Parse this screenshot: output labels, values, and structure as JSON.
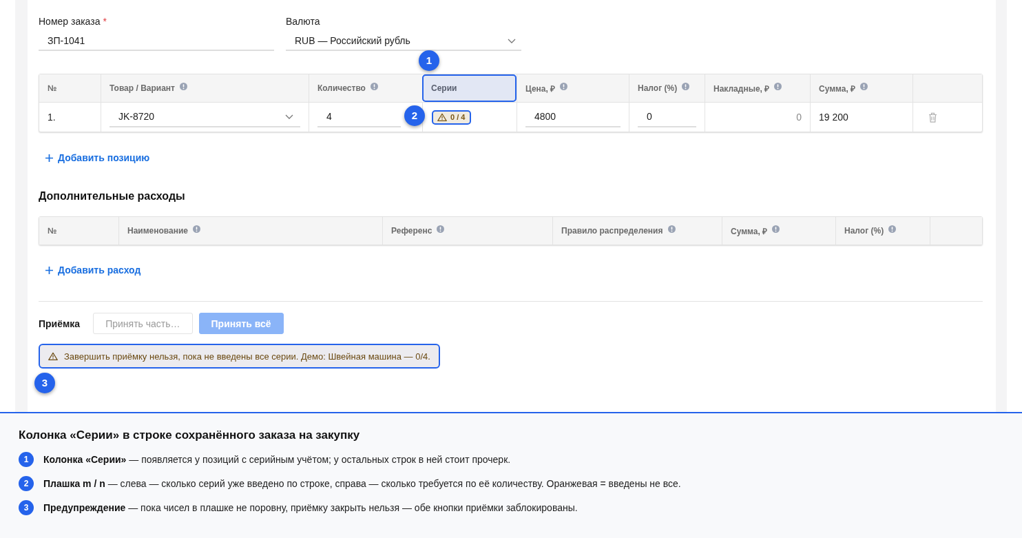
{
  "order_number": {
    "label": "Номер заказа",
    "required_mark": "*",
    "value": "ЗП-1041"
  },
  "currency": {
    "label": "Валюта",
    "value": "RUB — Российский рубль"
  },
  "items_table": {
    "columns": [
      {
        "label": "№",
        "info": false,
        "highlighted": false
      },
      {
        "label": "Товар / Вариант",
        "info": true,
        "highlighted": false
      },
      {
        "label": "Количество",
        "info": true,
        "highlighted": false
      },
      {
        "label": "Серии",
        "info": false,
        "highlighted": true,
        "callout": "1"
      },
      {
        "label": "Цена, ₽",
        "info": true,
        "highlighted": false
      },
      {
        "label": "Налог (%)",
        "info": true,
        "highlighted": false
      },
      {
        "label": "Накладные, ₽",
        "info": true,
        "highlighted": false
      },
      {
        "label": "Сумма, ₽",
        "info": true,
        "highlighted": false
      }
    ],
    "rows": [
      {
        "number": "1.",
        "product": "JK-8720",
        "quantity": "4",
        "series": {
          "text": "0 / 4",
          "complete": false,
          "highlighted": true,
          "callout": "2"
        },
        "price": "4800",
        "tax": "0",
        "overhead": "0",
        "sum": "19 200",
        "deletable": true
      }
    ],
    "add_label": "Добавить позицию"
  },
  "expenses": {
    "title": "Дополнительные расходы",
    "columns": [
      {
        "label": "№",
        "info": false
      },
      {
        "label": "Наименование",
        "info": true
      },
      {
        "label": "Референс",
        "info": true
      },
      {
        "label": "Правило распределения",
        "info": true
      },
      {
        "label": "Сумма, ₽",
        "info": true
      },
      {
        "label": "Налог (%)",
        "info": true
      }
    ],
    "add_label": "Добавить расход"
  },
  "receiving": {
    "label": "Приёмка",
    "buttons": [
      {
        "label": "Принять часть…",
        "kind": "secondary",
        "disabled": true
      },
      {
        "label": "Принять всё",
        "kind": "primary",
        "disabled": true
      }
    ],
    "warning": {
      "text": "Завершить приёмку нельзя, пока не введены все серии. Демо: Швейная машина — 0/4.",
      "highlighted": true,
      "callout": "3"
    }
  },
  "legend": {
    "title": "Колонка «Серии» в строке сохранённого заказа на закупку",
    "items": [
      {
        "number": "1",
        "text": "**Колонка «Серии»** — появляется у позиций с серийным учётом; у остальных строк в ней стоит прочерк."
      },
      {
        "number": "2",
        "text": "**Плашка m / n** — слева — сколько серий уже введено по строке, справа — сколько требуется по её количеству. Оранжевая = введены не все."
      },
      {
        "number": "3",
        "text": "**Предупреждение** — пока чисел в плашке не поровну, приёмку закрыть нельзя — обе кнопки приёмки заблокированы."
      }
    ]
  }
}
